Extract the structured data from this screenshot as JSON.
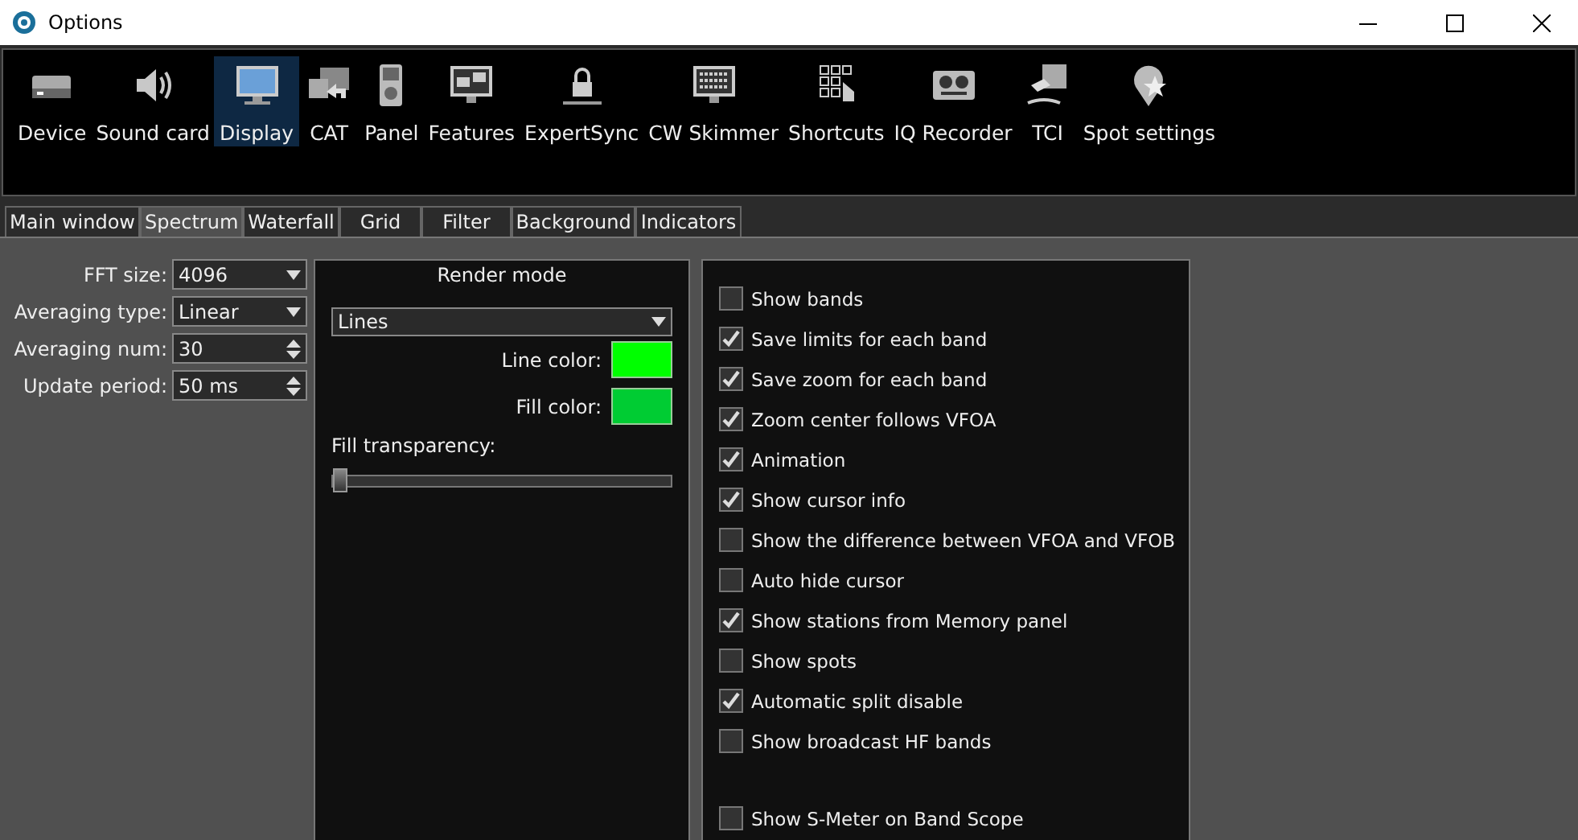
{
  "window": {
    "title": "Options"
  },
  "categories": [
    {
      "label": "Device",
      "selected": false
    },
    {
      "label": "Sound card",
      "selected": false
    },
    {
      "label": "Display",
      "selected": true
    },
    {
      "label": "CAT",
      "selected": false
    },
    {
      "label": "Panel",
      "selected": false
    },
    {
      "label": "Features",
      "selected": false
    },
    {
      "label": "ExpertSync",
      "selected": false
    },
    {
      "label": "CW Skimmer",
      "selected": false
    },
    {
      "label": "Shortcuts",
      "selected": false
    },
    {
      "label": "IQ Recorder",
      "selected": false
    },
    {
      "label": "TCI",
      "selected": false
    },
    {
      "label": "Spot settings",
      "selected": false
    }
  ],
  "tabs": [
    {
      "label": "Main window",
      "selected": false
    },
    {
      "label": "Spectrum",
      "selected": true
    },
    {
      "label": "Waterfall",
      "selected": false
    },
    {
      "label": "Grid",
      "selected": false
    },
    {
      "label": "Filter",
      "selected": false
    },
    {
      "label": "Background",
      "selected": false
    },
    {
      "label": "Indicators",
      "selected": false
    }
  ],
  "fields": [
    {
      "label": "FFT size:",
      "value": "4096",
      "kind": "combo"
    },
    {
      "label": "Averaging type:",
      "value": "Linear",
      "kind": "combo"
    },
    {
      "label": "Averaging num:",
      "value": "30",
      "kind": "spin"
    },
    {
      "label": "Update period:",
      "value": "50 ms",
      "kind": "spin"
    }
  ],
  "render": {
    "title": "Render mode",
    "mode": "Lines",
    "colors": [
      {
        "label": "Line color:",
        "color": "#00ff00"
      },
      {
        "label": "Fill color:",
        "color": "#00cc33"
      }
    ],
    "transparency": {
      "label": "Fill transparency:",
      "level": 0
    }
  },
  "options": [
    {
      "label": "Show bands",
      "checked": false
    },
    {
      "label": "Save limits for each band",
      "checked": true
    },
    {
      "label": "Save zoom for each band",
      "checked": true
    },
    {
      "label": "Zoom center follows VFOA",
      "checked": true
    },
    {
      "label": "Animation",
      "checked": true
    },
    {
      "label": "Show cursor info",
      "checked": true
    },
    {
      "label": "Show the difference between VFOA and VFOB",
      "checked": false
    },
    {
      "label": "Auto hide cursor",
      "checked": false
    },
    {
      "label": "Show stations from Memory panel",
      "checked": true
    },
    {
      "label": "Show spots",
      "checked": false
    },
    {
      "label": "Automatic split disable",
      "checked": true
    },
    {
      "label": "Show broadcast HF bands",
      "checked": false
    }
  ],
  "bottom_options": [
    {
      "label": "Show S-Meter on Band Scope",
      "checked": false
    }
  ]
}
